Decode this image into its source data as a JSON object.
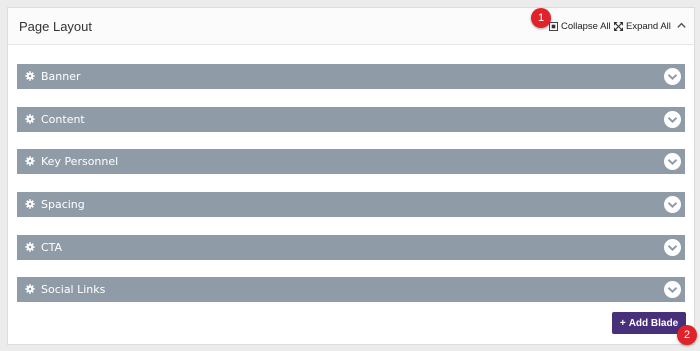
{
  "panel": {
    "title": "Page Layout",
    "collapse_all": "Collapse All",
    "expand_all": "Expand All"
  },
  "badges": [
    "1",
    "2"
  ],
  "blades": [
    {
      "label": "Banner"
    },
    {
      "label": "Content"
    },
    {
      "label": "Key Personnel"
    },
    {
      "label": "Spacing"
    },
    {
      "label": "CTA"
    },
    {
      "label": "Social Links"
    }
  ],
  "add_blade": {
    "icon": "+",
    "label": "Add Blade"
  },
  "colors": {
    "blade_bg": "#8f9ca8",
    "button_bg": "#472f7a",
    "badge_bg": "#e0232a"
  },
  "icons": [
    "collapse-icon",
    "expand-icon",
    "chevron-up-icon",
    "gear-icon",
    "chevron-down-icon",
    "plus-icon"
  ]
}
